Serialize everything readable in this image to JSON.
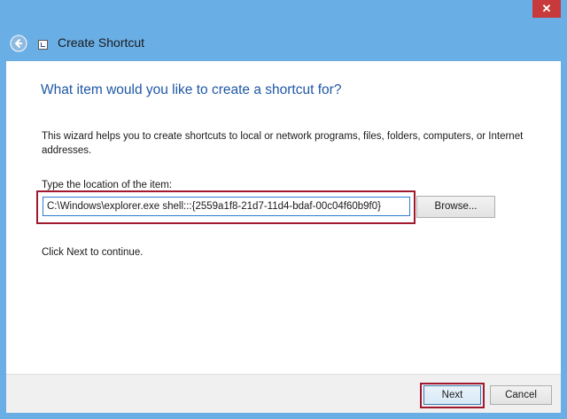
{
  "window": {
    "close_glyph": "✕",
    "title": "Create Shortcut"
  },
  "icons": {
    "back": "back-arrow-icon",
    "wizard": "shortcut-icon",
    "close": "close-icon"
  },
  "main": {
    "heading": "What item would you like to create a shortcut for?",
    "description": "This wizard helps you to create shortcuts to local or network programs, files, folders, computers, or Internet addresses.",
    "location_label": "Type the location of the item:",
    "location_value": "C:\\Windows\\explorer.exe shell:::{2559a1f8-21d7-11d4-bdaf-00c04f60b9f0}",
    "browse_label": "Browse...",
    "continue_text": "Click Next to continue."
  },
  "footer": {
    "next_label": "Next",
    "cancel_label": "Cancel"
  },
  "colors": {
    "frame": "#6aaee6",
    "heading": "#1f57a6",
    "highlight": "#a0192f",
    "close": "#c7393a"
  }
}
